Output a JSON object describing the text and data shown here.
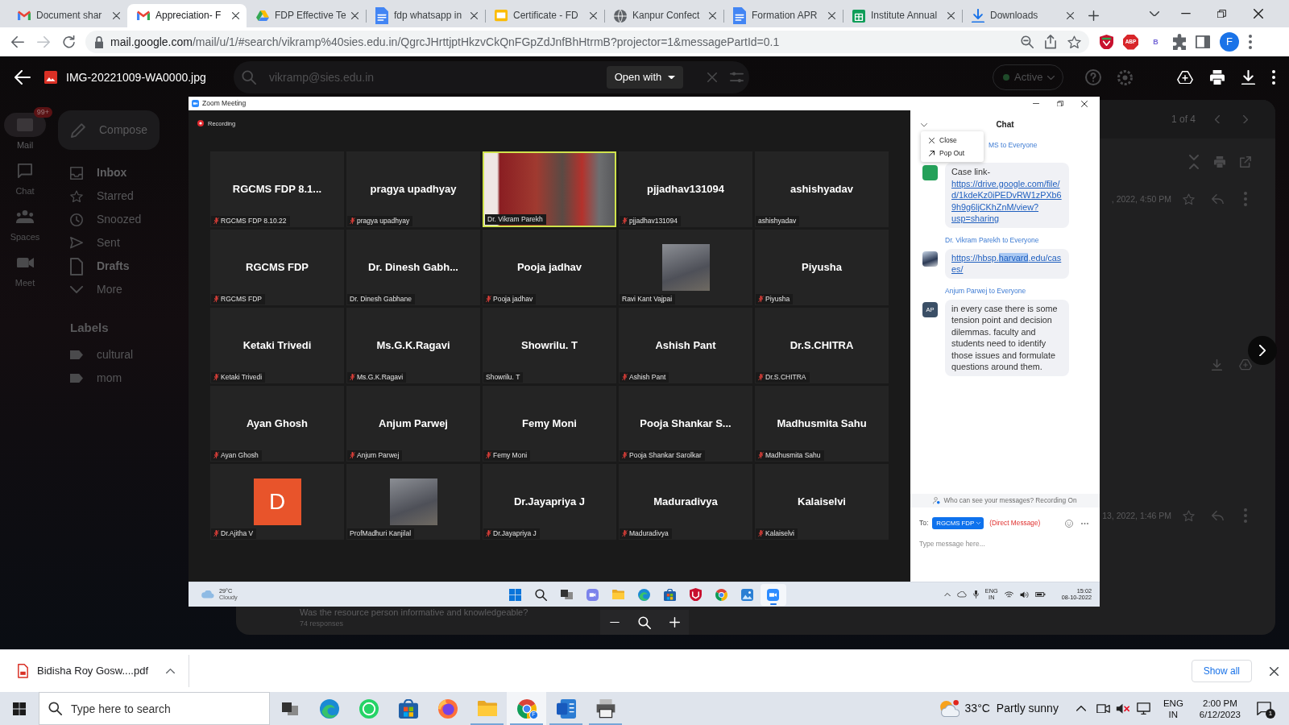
{
  "browser": {
    "tabs": [
      {
        "title": "Document shar",
        "kind": "gmail",
        "selected": false
      },
      {
        "title": "Appreciation- F",
        "kind": "gmail",
        "selected": true
      },
      {
        "title": "FDP Effective Te",
        "kind": "drive",
        "selected": false
      },
      {
        "title": "fdp whatsapp in",
        "kind": "docs",
        "selected": false
      },
      {
        "title": "Certificate - FD",
        "kind": "slides",
        "selected": false
      },
      {
        "title": "Kanpur Confect",
        "kind": "globe",
        "selected": false
      },
      {
        "title": "Formation APR",
        "kind": "docs",
        "selected": false
      },
      {
        "title": "Institute Annual",
        "kind": "sheets",
        "selected": false
      },
      {
        "title": "Downloads",
        "kind": "download",
        "selected": false
      }
    ],
    "nav": [
      {
        "kind": "back",
        "disabled": false
      },
      {
        "kind": "forward",
        "disabled": true
      },
      {
        "kind": "reload",
        "disabled": false
      }
    ],
    "address": {
      "host": "mail.google.com",
      "path": "/mail/u/1/#search/vikramp%40sies.edu.in/QgrcJHrttjptHkzvCkQnFGpZdJnfBhHtrmB?projector=1&messagePartId=0.1"
    },
    "extensions": [
      {
        "kind": "shield"
      },
      {
        "kind": "abp",
        "text": "ABP"
      },
      {
        "kind": "letter",
        "text": "B"
      },
      {
        "kind": "puzzle"
      }
    ],
    "profile": "F"
  },
  "gmail_background": {
    "rail": [
      {
        "kind": "mail",
        "label": "Mail",
        "badge": "99+",
        "selected": true
      },
      {
        "kind": "chat",
        "label": "Chat",
        "selected": false
      },
      {
        "kind": "spaces",
        "label": "Spaces",
        "selected": false
      },
      {
        "kind": "meet",
        "label": "Meet",
        "selected": false
      }
    ],
    "compose": "Compose",
    "folders": [
      {
        "kind": "inbox",
        "label": "Inbox",
        "unread": true
      },
      {
        "kind": "starred",
        "label": "Starred",
        "unread": false
      },
      {
        "kind": "snoozed",
        "label": "Snoozed",
        "unread": false
      },
      {
        "kind": "sent",
        "label": "Sent",
        "unread": false
      },
      {
        "kind": "drafts",
        "label": "Drafts",
        "unread": true
      },
      {
        "kind": "more",
        "label": "More",
        "unread": false
      }
    ],
    "labels_heading": "Labels",
    "labels": [
      "cultural",
      "mom"
    ],
    "search": "vikramp@sies.edu.in",
    "status": "Active",
    "pager": "1 of 4",
    "times": [
      ", 2022, 4:50 PM",
      "13, 2022, 1:46 PM"
    ],
    "form": {
      "question": "Was the resource person informative and knowledgeable?",
      "responses": "74 responses"
    }
  },
  "viewer": {
    "file_name": "IMG-20221009-WA0000.jpg",
    "open_with": "Open with"
  },
  "zoom_screenshot": {
    "window_title": "Zoom Meeting",
    "recording": "Recording",
    "tiles": [
      {
        "kind": "name",
        "name": "RGCMS FDP 8.1...",
        "label": "RGCMS FDP 8.10.22",
        "muted": true,
        "speaking": false
      },
      {
        "kind": "name",
        "name": "pragya upadhyay",
        "label": "pragya upadhyay",
        "muted": true,
        "speaking": false
      },
      {
        "kind": "video",
        "label": "Dr. Vikram Parekh",
        "muted": false,
        "speaking": true
      },
      {
        "kind": "name",
        "name": "pjjadhav131094",
        "label": "pjjadhav131094",
        "muted": true,
        "speaking": false
      },
      {
        "kind": "name",
        "name": "ashishyadav",
        "label": "ashishyadav",
        "muted": false,
        "speaking": false
      },
      {
        "kind": "name",
        "name": "RGCMS FDP",
        "label": "RGCMS FDP",
        "muted": true,
        "speaking": false
      },
      {
        "kind": "name",
        "name": "Dr. Dinesh Gabh...",
        "label": "Dr. Dinesh Gabhane",
        "muted": false,
        "speaking": false
      },
      {
        "kind": "name",
        "name": "Pooja jadhav",
        "label": "Pooja jadhav",
        "muted": true,
        "speaking": false
      },
      {
        "kind": "photo",
        "label": "Ravi Kant Vajpai",
        "muted": false,
        "speaking": false
      },
      {
        "kind": "name",
        "name": "Piyusha",
        "label": "Piyusha",
        "muted": true,
        "speaking": false
      },
      {
        "kind": "name",
        "name": "Ketaki Trivedi",
        "label": "Ketaki Trivedi",
        "muted": true,
        "speaking": false
      },
      {
        "kind": "name",
        "name": "Ms.G.K.Ragavi",
        "label": "Ms.G.K.Ragavi",
        "muted": true,
        "speaking": false
      },
      {
        "kind": "name",
        "name": "Showrilu. T",
        "label": "Showrilu. T",
        "muted": false,
        "speaking": false
      },
      {
        "kind": "name",
        "name": "Ashish Pant",
        "label": "Ashish Pant",
        "muted": true,
        "speaking": false
      },
      {
        "kind": "name",
        "name": "Dr.S.CHITRA",
        "label": "Dr.S.CHITRA",
        "muted": true,
        "speaking": false
      },
      {
        "kind": "name",
        "name": "Ayan Ghosh",
        "label": "Ayan Ghosh",
        "muted": true,
        "speaking": false
      },
      {
        "kind": "name",
        "name": "Anjum Parwej",
        "label": "Anjum Parwej",
        "muted": true,
        "speaking": false
      },
      {
        "kind": "name",
        "name": "Femy Moni",
        "label": "Femy Moni",
        "muted": true,
        "speaking": false
      },
      {
        "kind": "name",
        "name": "Pooja Shankar S...",
        "label": "Pooja Shankar Sarolkar",
        "muted": true,
        "speaking": false
      },
      {
        "kind": "name",
        "name": "Madhusmita Sahu",
        "label": "Madhusmita Sahu",
        "muted": true,
        "speaking": false
      },
      {
        "kind": "avatar",
        "initial": "D",
        "label": "Dr.Ajitha V",
        "muted": true,
        "speaking": false
      },
      {
        "kind": "photo",
        "label": "ProfMadhuri Kanjilal",
        "muted": false,
        "speaking": false
      },
      {
        "kind": "name",
        "name": "Dr.Jayapriya J",
        "label": "Dr.Jayapriya J",
        "muted": true,
        "speaking": false
      },
      {
        "kind": "name",
        "name": "Maduradivya",
        "label": "Maduradivya",
        "muted": true,
        "speaking": false
      },
      {
        "kind": "name",
        "name": "Kalaiselvi",
        "label": "Kalaiselvi",
        "muted": true,
        "speaking": false
      }
    ],
    "chat": {
      "title": "Chat",
      "menu": [
        {
          "kind": "close",
          "label": "Close"
        },
        {
          "kind": "popout",
          "label": "Pop Out"
        }
      ],
      "messages": [
        {
          "header": "MS to Everyone",
          "avatar": {
            "kind": "block"
          },
          "parts": [
            {
              "kind": "text",
              "text": "Case link-"
            },
            {
              "kind": "link",
              "segments": [
                {
                  "text": "https://drive.google.com/file/d/1kdeKz0iPEDvRW1zPXb69h9g6ljCKhZnM/view?usp=sharing",
                  "selected": false
                }
              ]
            }
          ]
        },
        {
          "header": "Dr. Vikram Parekh to Everyone",
          "avatar": {
            "kind": "photo"
          },
          "parts": [
            {
              "kind": "link",
              "segments": [
                {
                  "text": "https://hbsp.",
                  "selected": false
                },
                {
                  "text": "harvard",
                  "selected": true
                },
                {
                  "text": ".edu/cases/",
                  "selected": false
                }
              ]
            }
          ]
        },
        {
          "header": "Anjum Parwej to Everyone",
          "avatar": {
            "kind": "initials",
            "initials": "AP"
          },
          "parts": [
            {
              "kind": "text",
              "text": "in every case there is some tension point and decision dilemmas. faculty and students need to identify those issues and formulate questions around them."
            }
          ]
        }
      ],
      "privacy_note": "Who can see your messages? Recording On",
      "to_label": "To:",
      "recipient": "RGCMS FDP",
      "direct_note": "(Direct Message)",
      "placeholder": "Type message here..."
    },
    "taskbar": {
      "weather": {
        "temp": "29°C",
        "condition": "Cloudy"
      },
      "apps": [
        {
          "kind": "start",
          "selected": false
        },
        {
          "kind": "search",
          "selected": false
        },
        {
          "kind": "taskview",
          "selected": false
        },
        {
          "kind": "chat",
          "selected": false
        },
        {
          "kind": "explorer",
          "selected": false
        },
        {
          "kind": "edge",
          "selected": false
        },
        {
          "kind": "store",
          "selected": false
        },
        {
          "kind": "mcafee",
          "selected": false
        },
        {
          "kind": "chrome",
          "selected": false
        },
        {
          "kind": "photos",
          "selected": false
        },
        {
          "kind": "zoom",
          "selected": true
        }
      ],
      "lang": "ENG",
      "region": "IN",
      "time": "15:02",
      "date": "08-10-2022"
    }
  },
  "downloads_bar": {
    "file": "Bidisha Roy Gosw....pdf",
    "show_all": "Show all"
  },
  "taskbar": {
    "search_placeholder": "Type here to search",
    "apps": [
      {
        "kind": "taskview",
        "running": false,
        "selected": false
      },
      {
        "kind": "edge",
        "running": false,
        "selected": false
      },
      {
        "kind": "whatsapp",
        "running": false,
        "selected": false
      },
      {
        "kind": "store",
        "running": false,
        "selected": false
      },
      {
        "kind": "firefox",
        "running": false,
        "selected": false
      },
      {
        "kind": "explorer",
        "running": true,
        "selected": false
      },
      {
        "kind": "chrome",
        "running": true,
        "selected": true,
        "badge": "F"
      },
      {
        "kind": "word",
        "running": true,
        "selected": false
      },
      {
        "kind": "printer",
        "running": true,
        "selected": false
      }
    ],
    "weather": {
      "temp": "33°C",
      "condition": "Partly sunny"
    },
    "lang": "ENG",
    "region": "IN",
    "time": "2:00 PM",
    "date": "6/12/2023",
    "notifications": "1"
  }
}
